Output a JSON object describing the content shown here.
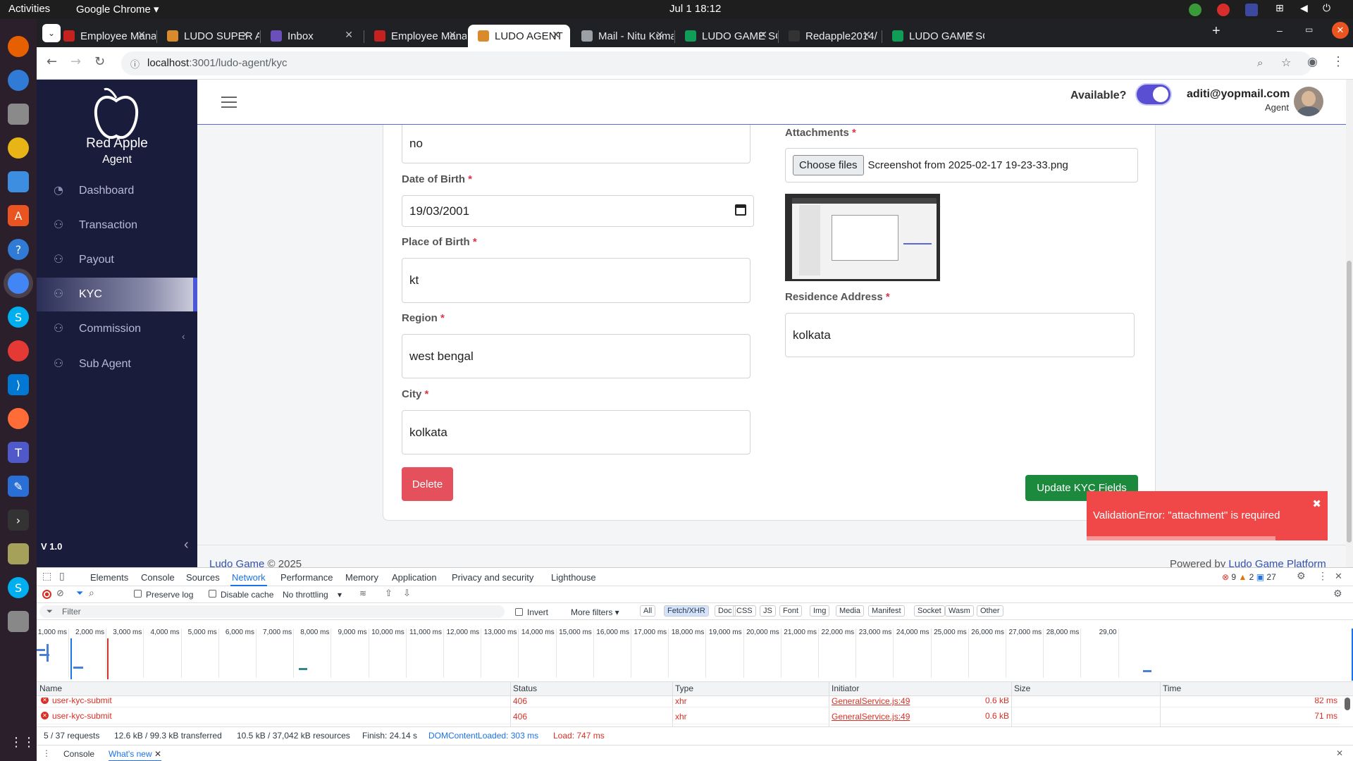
{
  "system": {
    "activities": "Activities",
    "app": "Google Chrome",
    "clock": "Jul 1  18:12"
  },
  "browser": {
    "tabs": [
      {
        "label": "Employee Mana",
        "fav": "#c5221f"
      },
      {
        "label": "LUDO SUPER AD",
        "fav": "#d98b2b"
      },
      {
        "label": "Inbox",
        "fav": "#6b4fbb"
      },
      {
        "label": "Employee Mana",
        "fav": "#c5221f"
      },
      {
        "label": "LUDO AGENT",
        "fav": "#d98b2b"
      },
      {
        "label": "Mail - Nitu Kuma",
        "fav": "#9aa0a6"
      },
      {
        "label": "LUDO GAME SO",
        "fav": "#0f9d58"
      },
      {
        "label": "Redapple2014/",
        "fav": "#333333"
      },
      {
        "label": "LUDO GAME SO",
        "fav": "#0f9d58"
      }
    ],
    "active_tab": 4,
    "url_host": "localhost",
    "url_rest": ":3001/ludo-agent/kyc"
  },
  "sidebar": {
    "brand": "Red Apple",
    "role": "Agent",
    "items": [
      {
        "label": "Dashboard",
        "icon": "dashboard-icon"
      },
      {
        "label": "Transaction",
        "icon": "user-icon"
      },
      {
        "label": "Payout",
        "icon": "user-icon"
      },
      {
        "label": "KYC",
        "icon": "user-icon"
      },
      {
        "label": "Commission",
        "icon": "user-icon"
      },
      {
        "label": "Sub Agent",
        "icon": "user-icon"
      }
    ],
    "active": "KYC",
    "version": "V 1.0"
  },
  "header": {
    "available_label": "Available?",
    "available_on": true,
    "email": "aditi@yopmail.com",
    "role": "Agent"
  },
  "form": {
    "top_value": "no",
    "dob_label": "Date of Birth",
    "dob_value": "19/03/2001",
    "pob_label": "Place of Birth",
    "pob_value": "kt",
    "region_label": "Region",
    "region_value": "west bengal",
    "city_label": "City",
    "city_value": "kolkata",
    "attachments_label": "Attachments",
    "choose_files": "Choose files",
    "file_name": "Screenshot from 2025-02-17 19-23-33.png",
    "residence_label": "Residence Address",
    "residence_value": "kolkata",
    "required_mark": "*",
    "delete_label": "Delete",
    "update_label": "Update KYC Fields"
  },
  "toast": {
    "message": "ValidationError: \"attachment\" is required"
  },
  "footer": {
    "left_link": "Ludo Game",
    "left_rest": " © 2025",
    "right_text": "Powered by ",
    "right_link": "Ludo Game Platform"
  },
  "devtools": {
    "tabs": [
      "Elements",
      "Console",
      "Sources",
      "Network",
      "Performance",
      "Memory",
      "Application",
      "Privacy and security",
      "Lighthouse"
    ],
    "active": "Network",
    "errors": "9",
    "warnings": "2",
    "messages": "27",
    "preserve_log": "Preserve log",
    "disable_cache": "Disable cache",
    "throttling": "No throttling",
    "filter_placeholder": "Filter",
    "invert": "Invert",
    "more_filters": "More filters",
    "chips": [
      "All",
      "Fetch/XHR",
      "Doc",
      "CSS",
      "JS",
      "Font",
      "Img",
      "Media",
      "Manifest",
      "Socket",
      "Wasm",
      "Other"
    ],
    "active_chip": "Fetch/XHR",
    "ticks": [
      "1,000 ms",
      "2,000 ms",
      "3,000 ms",
      "4,000 ms",
      "5,000 ms",
      "6,000 ms",
      "7,000 ms",
      "8,000 ms",
      "9,000 ms",
      "10,000 ms",
      "11,000 ms",
      "12,000 ms",
      "13,000 ms",
      "14,000 ms",
      "15,000 ms",
      "16,000 ms",
      "17,000 ms",
      "18,000 ms",
      "19,000 ms",
      "20,000 ms",
      "21,000 ms",
      "22,000 ms",
      "23,000 ms",
      "24,000 ms",
      "25,000 ms",
      "26,000 ms",
      "27,000 ms",
      "28,000 ms",
      "29,00"
    ],
    "columns": [
      "Name",
      "Status",
      "Type",
      "Initiator",
      "Size",
      "Time"
    ],
    "rows": [
      {
        "name": "user-kyc-submit",
        "status": "406",
        "type": "xhr",
        "initiator": "GeneralService.js:49",
        "size": "0.6 kB",
        "time": "82 ms"
      },
      {
        "name": "user-kyc-submit",
        "status": "406",
        "type": "xhr",
        "initiator": "GeneralService.js:49",
        "size": "0.6 kB",
        "time": "71 ms"
      }
    ],
    "summary": {
      "requests": "5 / 37 requests",
      "transferred": "12.6 kB / 99.3 kB transferred",
      "resources": "10.5 kB / 37,042 kB resources",
      "finish": "Finish: 24.14 s",
      "dcl": "DOMContentLoaded: 303 ms",
      "load": "Load: 747 ms"
    },
    "drawer_tabs": [
      "Console",
      "What's new"
    ]
  }
}
